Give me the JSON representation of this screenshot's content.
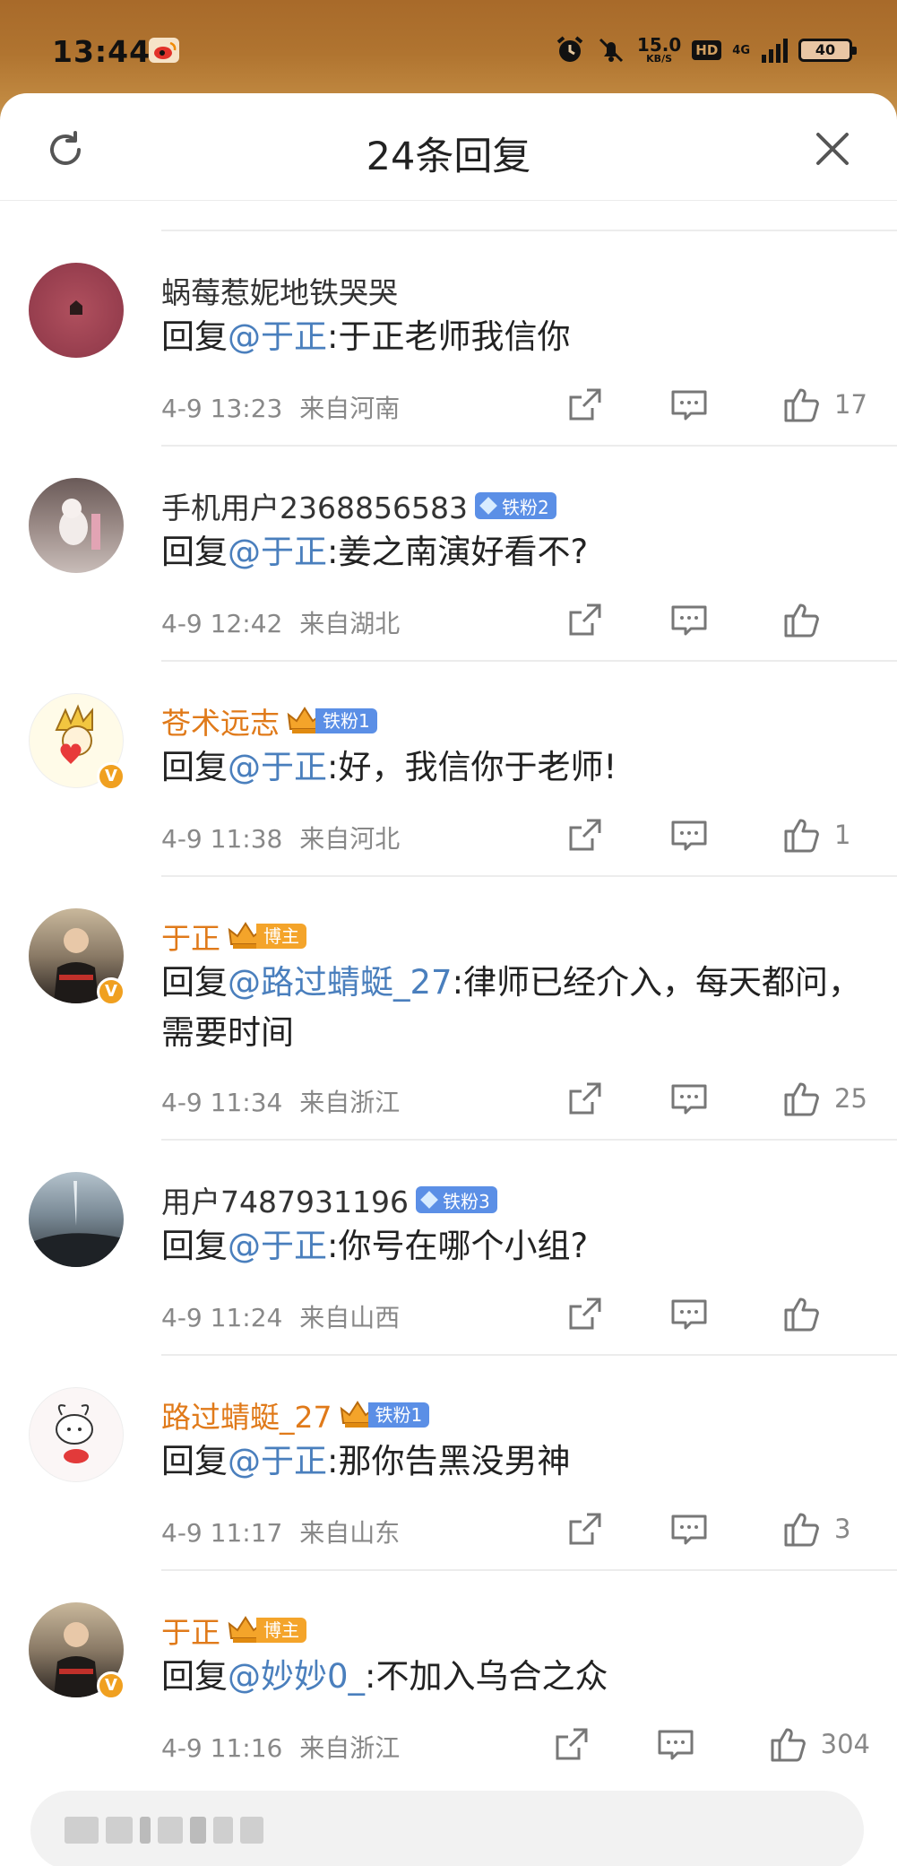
{
  "status_bar": {
    "time": "13:44",
    "speed_value": "15.0",
    "speed_unit": "KB/S",
    "hd": "HD",
    "network": "4G",
    "battery": "40"
  },
  "header": {
    "title": "24条回复"
  },
  "comments": [
    {
      "username": "蜗莓惹妮地铁哭哭",
      "reply_prefix": "回复",
      "mention": "@于正",
      "body": ":于正老师我信你",
      "date": "4-9 13:23",
      "location": "来自河南",
      "likes": "17"
    },
    {
      "username": "手机用户2368856583",
      "badge": "铁粉2",
      "reply_prefix": "回复",
      "mention": "@于正",
      "body": ":姜之南演好看不?",
      "date": "4-9 12:42",
      "location": "来自湖北",
      "likes": ""
    },
    {
      "username": "苍术远志",
      "badge": "铁粉1",
      "reply_prefix": "回复",
      "mention": "@于正",
      "body": ":好，我信你于老师!",
      "date": "4-9 11:38",
      "location": "来自河北",
      "likes": "1"
    },
    {
      "username": "于正",
      "badge": "博主",
      "reply_prefix": "回复",
      "mention": "@路过蜻蜓_27",
      "body": ":律师已经介入，每天都问，需要时间",
      "date": "4-9 11:34",
      "location": "来自浙江",
      "likes": "25"
    },
    {
      "username": "用户7487931196",
      "badge": "铁粉3",
      "reply_prefix": "回复",
      "mention": "@于正",
      "body": ":你号在哪个小组?",
      "date": "4-9 11:24",
      "location": "来自山西",
      "likes": ""
    },
    {
      "username": "路过蜻蜓_27",
      "badge": "铁粉1",
      "reply_prefix": "回复",
      "mention": "@于正",
      "body": ":那你告黑没男神",
      "date": "4-9 11:17",
      "location": "来自山东",
      "likes": "3"
    },
    {
      "username": "于正",
      "badge": "博主",
      "reply_prefix": "回复",
      "mention": "@妙妙0_",
      "body": ":不加入乌合之众",
      "date": "4-9 11:16",
      "location": "来自浙江",
      "likes": "304"
    }
  ],
  "colors": {
    "mention": "#4a7fbd",
    "vip_name": "#e07a1a",
    "fan_badge": "#5b8fe6",
    "host_badge": "#f4a42a"
  }
}
